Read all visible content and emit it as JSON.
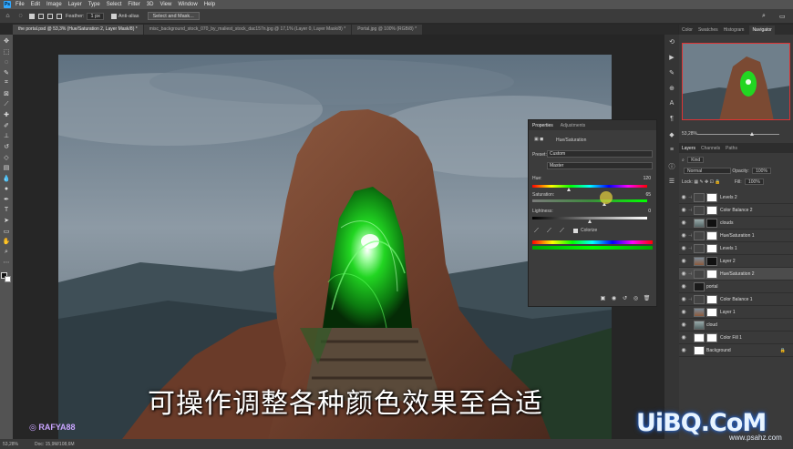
{
  "menu": {
    "logo": "Ps",
    "items": [
      "File",
      "Edit",
      "Image",
      "Layer",
      "Type",
      "Select",
      "Filter",
      "3D",
      "View",
      "Window",
      "Help"
    ]
  },
  "options": {
    "feather_label": "Feather:",
    "feather_value": "1 px",
    "antialias_label": "Anti-alias",
    "select_mask_label": "Select and Mask..."
  },
  "tabs": [
    {
      "label": "the portal.psd @ 53,3% (Hue/Saturation 2, Layer Mask/8) *",
      "active": true
    },
    {
      "label": "misc_background_stock_070_by_maliest_stock_dac157n.jpg @ 17,1% (Layer 0, Layer Mask/8) *",
      "active": false
    },
    {
      "label": "Portal.jpg @ 100% (RGB/8) *",
      "active": false
    }
  ],
  "properties": {
    "tab_properties": "Properties",
    "tab_adjustments": "Adjustments",
    "adjustment_name": "Hue/Saturation",
    "preset_label": "Preset:",
    "preset_value": "Custom",
    "channel_value": "Master",
    "hue_label": "Hue:",
    "hue_value": "120",
    "saturation_label": "Saturation:",
    "saturation_value": "65",
    "lightness_label": "Lightness:",
    "lightness_value": "0",
    "colorize_label": "Colorize",
    "hue_position": 0.32,
    "saturation_position": 0.63,
    "lightness_position": 0.5
  },
  "right_panel": {
    "tabs": [
      "Color",
      "Swatches",
      "Histogram",
      "Navigator"
    ],
    "zoom": "53,28%",
    "layer_tabs": [
      "Layers",
      "Channels",
      "Paths"
    ],
    "kind_label": "Kind",
    "blend_mode": "Normal",
    "opacity_label": "Opacity:",
    "opacity_value": "100%",
    "lock_label": "Lock:",
    "fill_label": "Fill:",
    "fill_value": "100%",
    "layers": [
      {
        "name": "Levels 2",
        "thumb": "adj",
        "mask": "white",
        "active": false
      },
      {
        "name": "Color Balance 2",
        "thumb": "adj",
        "mask": "white",
        "active": false
      },
      {
        "name": "clouds",
        "thumb": "sky",
        "mask": "black",
        "active": false
      },
      {
        "name": "Hue/Saturation 1",
        "thumb": "adj",
        "mask": "white",
        "active": false
      },
      {
        "name": "Levels 1",
        "thumb": "adj",
        "mask": "white",
        "active": false
      },
      {
        "name": "Layer 2",
        "thumb": "photo",
        "mask": "black",
        "active": false
      },
      {
        "name": "Hue/Saturation 2",
        "thumb": "adj",
        "mask": "white",
        "active": true
      },
      {
        "name": "portal",
        "thumb": "green",
        "mask": "none",
        "active": false
      },
      {
        "name": "Color Balance 1",
        "thumb": "adj",
        "mask": "white",
        "active": false
      },
      {
        "name": "Layer 1",
        "thumb": "photo",
        "mask": "white",
        "active": false
      },
      {
        "name": "cloud",
        "thumb": "sky",
        "mask": "none",
        "active": false
      },
      {
        "name": "Color Fill 1",
        "thumb": "white",
        "mask": "white",
        "active": false
      },
      {
        "name": "Background",
        "thumb": "white",
        "mask": "none",
        "active": false,
        "locked": true
      }
    ]
  },
  "status": {
    "zoom": "53,28%",
    "doc": "Doc: 15,9M/108,6M"
  },
  "overlay": {
    "subtitle": "可操作调整各种颜色效果至合适",
    "watermark_name": "RAFYA88",
    "watermark_logo": "UiBQ.CoM",
    "watermark_url": "www.psahz.com"
  },
  "colors": {
    "accent": "#31a8ff",
    "portal_green": "#22d622",
    "panel_bg": "#3c3c3c"
  }
}
